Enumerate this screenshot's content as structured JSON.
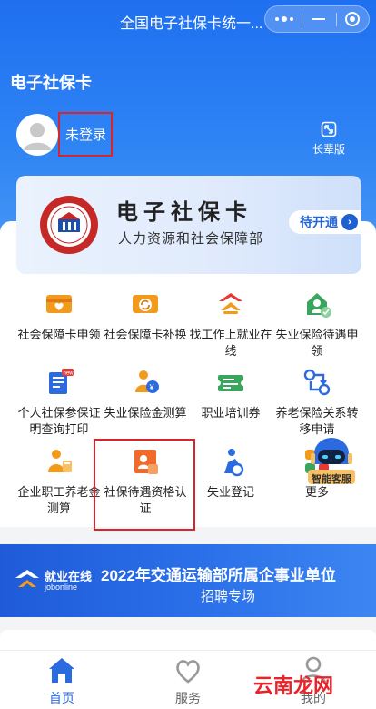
{
  "titlebar": {
    "title": "全国电子社保卡统一..."
  },
  "app": {
    "title": "电子社保卡"
  },
  "user": {
    "login_text": "未登录"
  },
  "elder_mode": {
    "label": "长辈版"
  },
  "banner": {
    "title": "电子社保卡",
    "subtitle": "人力资源和社会保障部",
    "pending_label": "待开通"
  },
  "services": [
    {
      "label": "社会保障卡申领",
      "icon": "card-apply-icon"
    },
    {
      "label": "社会保障卡补换",
      "icon": "card-replace-icon"
    },
    {
      "label": "找工作上就业在线",
      "icon": "job-search-icon"
    },
    {
      "label": "失业保险待遇申领",
      "icon": "unemployment-benefit-icon"
    },
    {
      "label": "个人社保参保证明查询打印",
      "icon": "print-certificate-icon"
    },
    {
      "label": "失业保险金测算",
      "icon": "unemployment-calc-icon"
    },
    {
      "label": "职业培训券",
      "icon": "training-voucher-icon"
    },
    {
      "label": "养老保险关系转移申请",
      "icon": "pension-transfer-icon"
    },
    {
      "label": "企业职工养老金测算",
      "icon": "pension-calc-icon"
    },
    {
      "label": "社保待遇资格认证",
      "icon": "qualification-verify-icon"
    },
    {
      "label": "失业登记",
      "icon": "unemployment-register-icon"
    },
    {
      "label": "更多",
      "icon": "more-icon"
    }
  ],
  "ai_service": {
    "label": "智能客服"
  },
  "promo": {
    "logo_cn": "就业在线",
    "logo_en": "jobonline",
    "title": "2022年交通运输部所属企事业单位",
    "subtitle": "招聘专场"
  },
  "tabs": [
    {
      "label": "首页",
      "active": true
    },
    {
      "label": "服务",
      "active": false
    },
    {
      "label": "我的",
      "active": false
    }
  ],
  "watermark": {
    "text": "云南龙网"
  },
  "colors": {
    "primary": "#2c6ae0",
    "header": "#1f6ff0",
    "highlight": "#d8242a",
    "orange": "#f29a1c"
  }
}
